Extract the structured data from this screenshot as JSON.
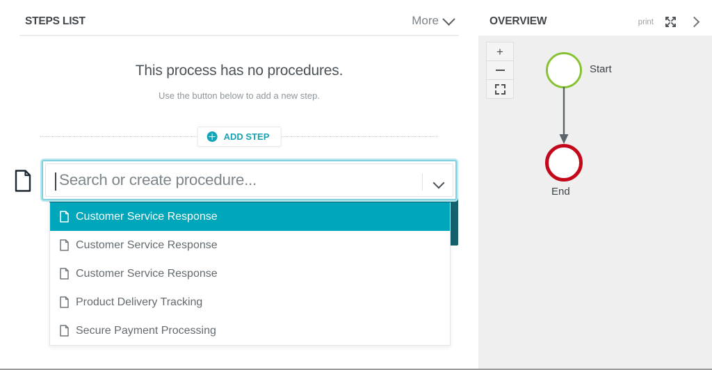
{
  "steps_panel": {
    "title": "STEPS LIST",
    "more_label": "More",
    "empty_title": "This process has no procedures.",
    "empty_subtitle": "Use the button below to add a new step.",
    "add_step_label": "ADD STEP",
    "row_icon": "document-icon",
    "combobox": {
      "placeholder": "Search or create procedure...",
      "value": "",
      "caret_icon": "chevron-down-icon"
    },
    "dropdown": {
      "items": [
        {
          "label": "Customer Service Response",
          "icon": "document-icon",
          "selected": true
        },
        {
          "label": "Customer Service Response",
          "icon": "document-icon",
          "selected": false
        },
        {
          "label": "Customer Service Response",
          "icon": "document-icon",
          "selected": false
        },
        {
          "label": "Product Delivery Tracking",
          "icon": "document-icon",
          "selected": false
        },
        {
          "label": "Secure Payment Processing",
          "icon": "document-icon",
          "selected": false
        }
      ]
    }
  },
  "overview_panel": {
    "title": "OVERVIEW",
    "print_label": "print",
    "expand_icon": "fullscreen-icon",
    "collapse_icon": "chevron-right-icon",
    "zoom_controls": {
      "zoom_in_label": "+",
      "zoom_out_label": "−",
      "fit_label": "fit-to-screen-icon"
    },
    "diagram": {
      "start_label": "Start",
      "end_label": "End"
    }
  },
  "colors": {
    "accent_teal": "#00a6ba",
    "accent_teal_dark": "#14626e",
    "add_step_teal": "#17a2b4",
    "start_green": "#86c232",
    "end_red": "#c4081c",
    "canvas_gray": "#efefef"
  }
}
